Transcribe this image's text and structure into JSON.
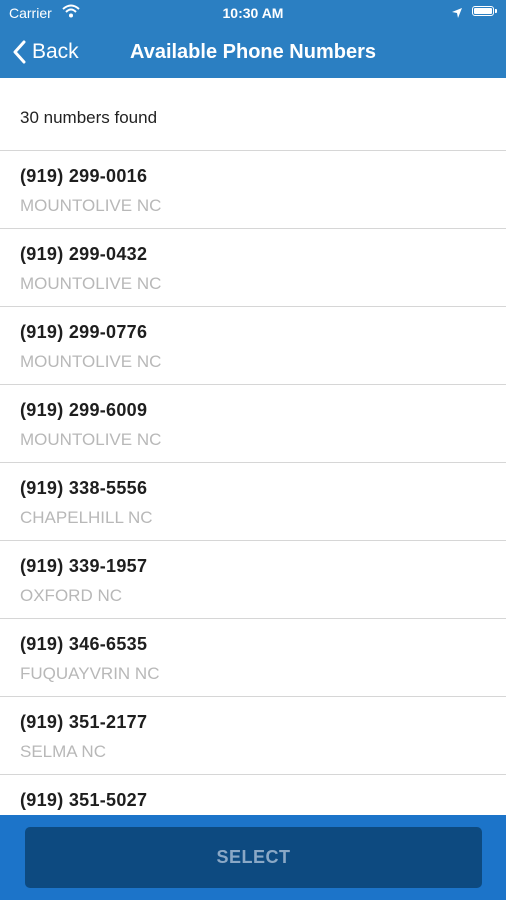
{
  "status_bar": {
    "carrier": "Carrier",
    "time": "10:30 AM"
  },
  "nav": {
    "back_label": "Back",
    "title": "Available Phone Numbers"
  },
  "results": {
    "count_text": "30 numbers found"
  },
  "numbers": [
    {
      "number": "(919) 299-0016",
      "location": "MOUNTOLIVE NC"
    },
    {
      "number": "(919) 299-0432",
      "location": "MOUNTOLIVE NC"
    },
    {
      "number": "(919) 299-0776",
      "location": "MOUNTOLIVE NC"
    },
    {
      "number": "(919) 299-6009",
      "location": "MOUNTOLIVE NC"
    },
    {
      "number": "(919) 338-5556",
      "location": "CHAPELHILL NC"
    },
    {
      "number": "(919) 339-1957",
      "location": "OXFORD NC"
    },
    {
      "number": "(919) 346-6535",
      "location": "FUQUAYVRIN NC"
    },
    {
      "number": "(919) 351-2177",
      "location": "SELMA NC"
    },
    {
      "number": "(919) 351-5027",
      "location": ""
    }
  ],
  "footer": {
    "select_label": "SELECT"
  },
  "colors": {
    "header_bg": "#2b7fc2",
    "footer_bg": "#1c74c9",
    "button_bg": "#0d4a80",
    "location_text": "#b8b8b8"
  }
}
